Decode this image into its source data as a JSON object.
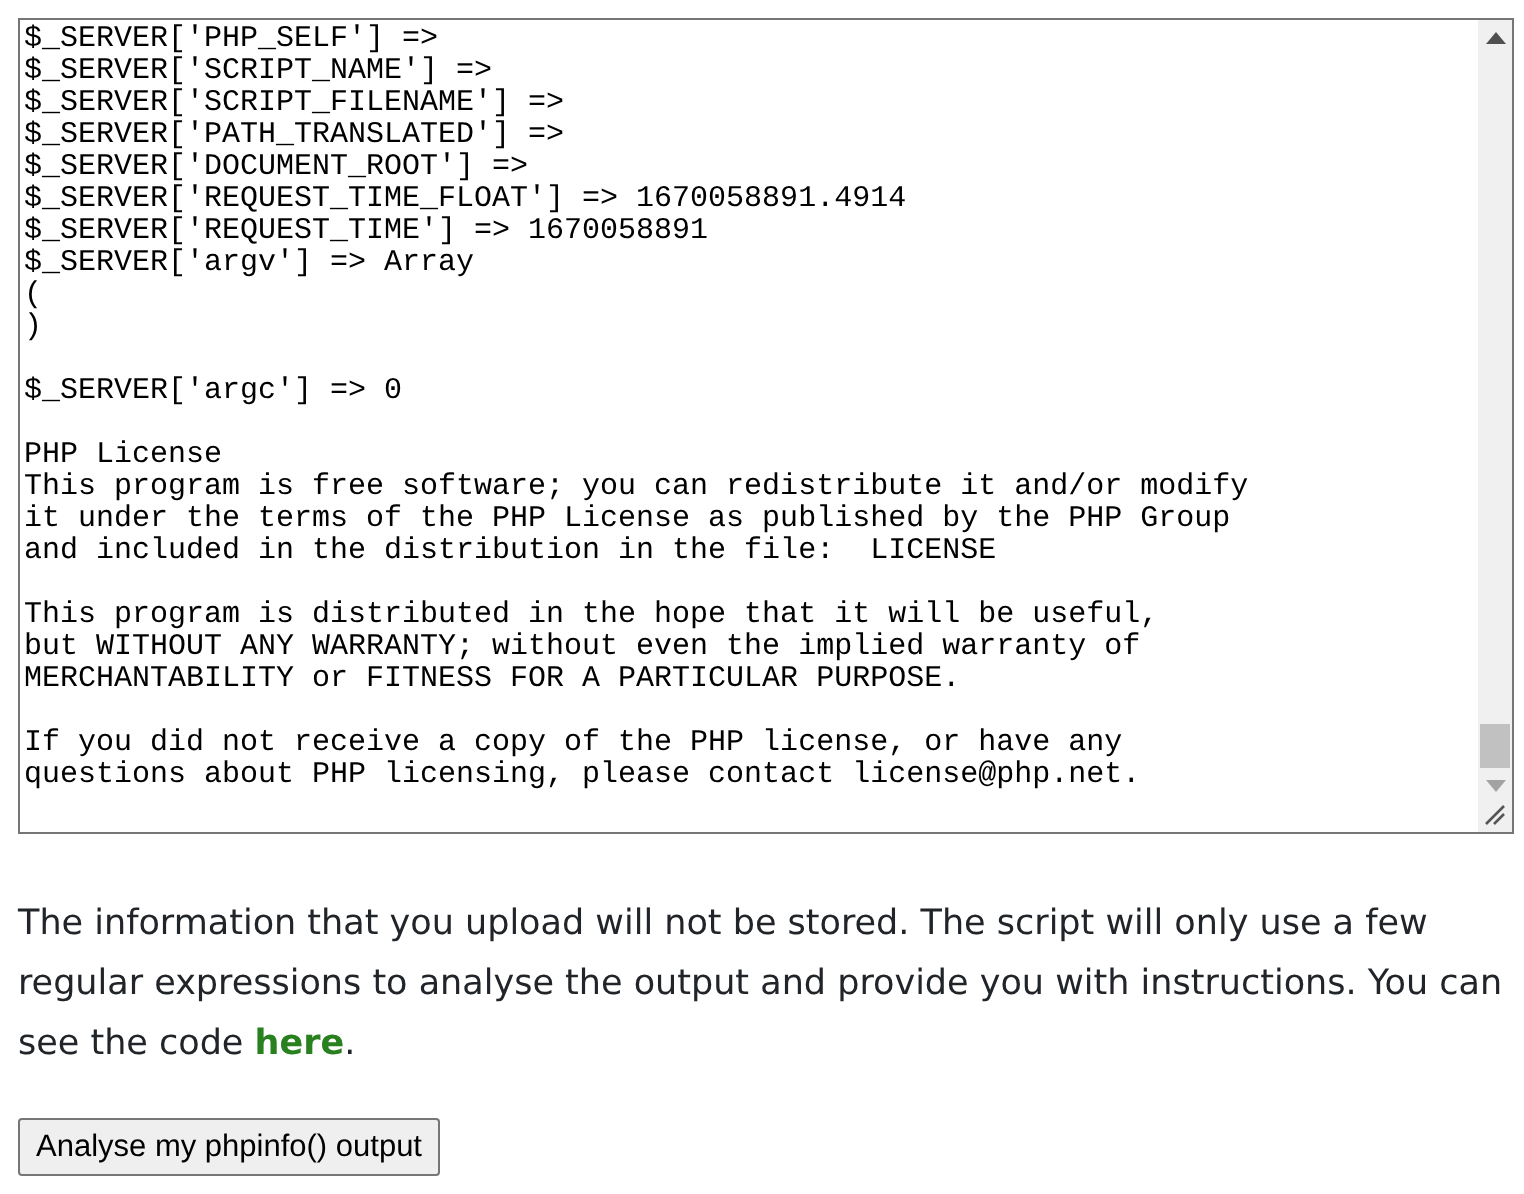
{
  "output_box": {
    "blocks": [
      [
        "$_SERVER['PHP_SELF'] =>",
        "$_SERVER['SCRIPT_NAME'] =>",
        "$_SERVER['SCRIPT_FILENAME'] =>",
        "$_SERVER['PATH_TRANSLATED'] =>",
        "$_SERVER['DOCUMENT_ROOT'] =>",
        "$_SERVER['REQUEST_TIME_FLOAT'] => 1670058891.4914",
        "$_SERVER['REQUEST_TIME'] => 1670058891",
        "$_SERVER['argv'] => Array",
        "(",
        ")"
      ],
      [
        "$_SERVER['argc'] => 0"
      ],
      [
        "PHP License",
        "This program is free software; you can redistribute it and/or modify",
        "it under the terms of the PHP License as published by the PHP Group",
        "and included in the distribution in the file:  LICENSE"
      ],
      [
        "This program is distributed in the hope that it will be useful,",
        "but WITHOUT ANY WARRANTY; without even the implied warranty of",
        "MERCHANTABILITY or FITNESS FOR A PARTICULAR PURPOSE."
      ],
      [
        "If you did not receive a copy of the PHP license, or have any",
        "questions about PHP licensing, please contact license@php.net."
      ]
    ]
  },
  "info": {
    "text": "The information that you upload will not be stored. The script will only use a few regular expressions to analyse the output and provide you with instructions. You can see the code ",
    "link": "here",
    "end": "."
  },
  "button": "Analyse my phpinfo() output"
}
